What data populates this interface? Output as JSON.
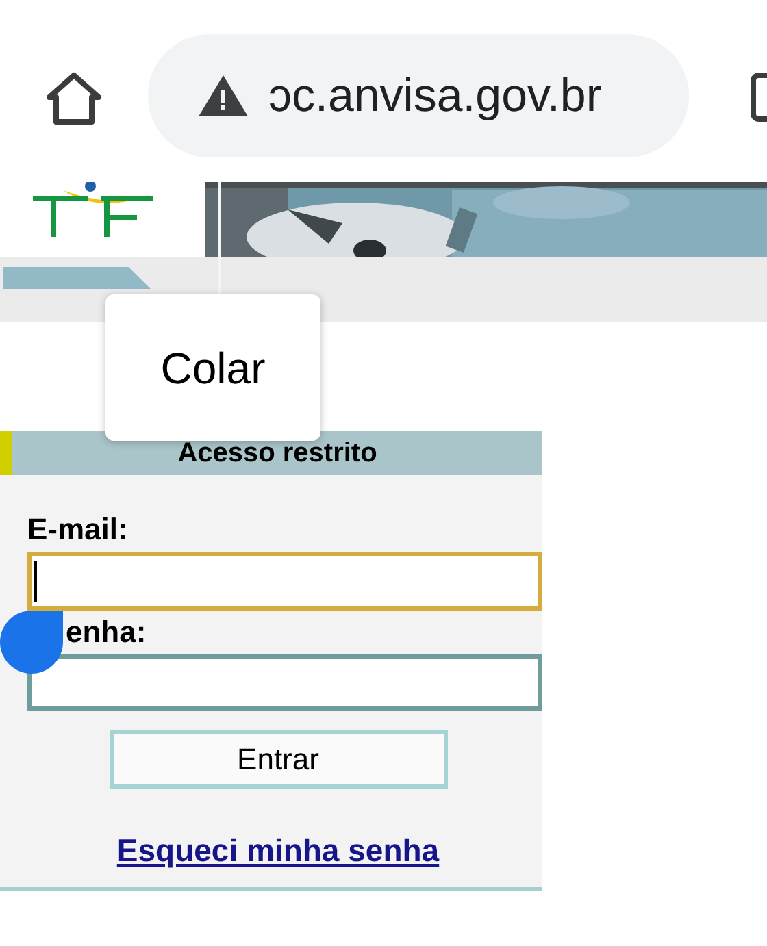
{
  "browser": {
    "url": "ɔc.anvisa.gov.br",
    "insecure": true
  },
  "context_menu": {
    "items": [
      "Colar"
    ]
  },
  "login": {
    "title": "Acesso restrito",
    "fields": [
      {
        "label": "E-mail:",
        "focused": true
      },
      {
        "label": "enha:",
        "focused": false
      }
    ],
    "button": "Entrar",
    "link": "Esqueci minha senha"
  }
}
